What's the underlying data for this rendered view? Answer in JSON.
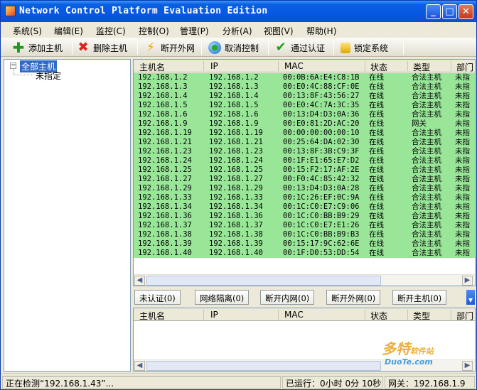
{
  "window": {
    "title": "Network Control Platform Evaluation Edition"
  },
  "menu": [
    "系统(S)",
    "编辑(E)",
    "监控(C)",
    "控制(O)",
    "管理(P)",
    "分析(A)",
    "视图(V)",
    "帮助(H)"
  ],
  "toolbar": {
    "add": "添加主机",
    "delete": "删除主机",
    "disconnect_ext": "断开外网",
    "cancel_control": "取消控制",
    "pass_auth": "通过认证",
    "lock": "锁定系统"
  },
  "tree": {
    "root": "全部主机",
    "child": "未指定"
  },
  "columns": [
    "主机名",
    "IP",
    "MAC",
    "状态",
    "类型",
    "部门"
  ],
  "hosts": [
    {
      "name": "192.168.1.2",
      "ip": "192.168.1.2",
      "mac": "00:0B:6A:E4:C8:1B",
      "status": "在线",
      "type": "合法主机",
      "dept": "未指"
    },
    {
      "name": "192.168.1.3",
      "ip": "192.168.1.3",
      "mac": "00:E0:4C:88:CF:0E",
      "status": "在线",
      "type": "合法主机",
      "dept": "未指"
    },
    {
      "name": "192.168.1.4",
      "ip": "192.168.1.4",
      "mac": "00:13:8F:43:56:27",
      "status": "在线",
      "type": "合法主机",
      "dept": "未指"
    },
    {
      "name": "192.168.1.5",
      "ip": "192.168.1.5",
      "mac": "00:E0:4C:7A:3C:35",
      "status": "在线",
      "type": "合法主机",
      "dept": "未指"
    },
    {
      "name": "192.168.1.6",
      "ip": "192.168.1.6",
      "mac": "00:13:D4:D3:0A:36",
      "status": "在线",
      "type": "合法主机",
      "dept": "未指"
    },
    {
      "name": "192.168.1.9",
      "ip": "192.168.1.9",
      "mac": "00:E0:81:2D:AC:20",
      "status": "在线",
      "type": "网关",
      "dept": "未指"
    },
    {
      "name": "192.168.1.19",
      "ip": "192.168.1.19",
      "mac": "00:00:00:00:00:10",
      "status": "在线",
      "type": "合法主机",
      "dept": "未指"
    },
    {
      "name": "192.168.1.21",
      "ip": "192.168.1.21",
      "mac": "00:25:64:DA:02:30",
      "status": "在线",
      "type": "合法主机",
      "dept": "未指"
    },
    {
      "name": "192.168.1.23",
      "ip": "192.168.1.23",
      "mac": "00:13:8F:3B:C9:3F",
      "status": "在线",
      "type": "合法主机",
      "dept": "未指"
    },
    {
      "name": "192.168.1.24",
      "ip": "192.168.1.24",
      "mac": "00:1F:E1:65:E7:D2",
      "status": "在线",
      "type": "合法主机",
      "dept": "未指"
    },
    {
      "name": "192.168.1.25",
      "ip": "192.168.1.25",
      "mac": "00:15:F2:17:AF:2E",
      "status": "在线",
      "type": "合法主机",
      "dept": "未指"
    },
    {
      "name": "192.168.1.27",
      "ip": "192.168.1.27",
      "mac": "00:F0:4C:85:42:32",
      "status": "在线",
      "type": "合法主机",
      "dept": "未指"
    },
    {
      "name": "192.168.1.29",
      "ip": "192.168.1.29",
      "mac": "00:13:D4:D3:0A:28",
      "status": "在线",
      "type": "合法主机",
      "dept": "未指"
    },
    {
      "name": "192.168.1.33",
      "ip": "192.168.1.33",
      "mac": "00:1C:26:EF:0C:9A",
      "status": "在线",
      "type": "合法主机",
      "dept": "未指"
    },
    {
      "name": "192.168.1.34",
      "ip": "192.168.1.34",
      "mac": "00:1C:C0:E7:C9:06",
      "status": "在线",
      "type": "合法主机",
      "dept": "未指"
    },
    {
      "name": "192.168.1.36",
      "ip": "192.168.1.36",
      "mac": "00:1C:C0:BB:B9:29",
      "status": "在线",
      "type": "合法主机",
      "dept": "未指"
    },
    {
      "name": "192.168.1.37",
      "ip": "192.168.1.37",
      "mac": "00:1C:C0:E7:E1:26",
      "status": "在线",
      "type": "合法主机",
      "dept": "未指"
    },
    {
      "name": "192.168.1.38",
      "ip": "192.168.1.38",
      "mac": "00:1C:C0:BB:B9:B3",
      "status": "在线",
      "type": "合法主机",
      "dept": "未指"
    },
    {
      "name": "192.168.1.39",
      "ip": "192.168.1.39",
      "mac": "00:15:17:9C:62:6E",
      "status": "在线",
      "type": "合法主机",
      "dept": "未指"
    },
    {
      "name": "192.168.1.40",
      "ip": "192.168.1.40",
      "mac": "00:1F:D0:53:DD:54",
      "status": "在线",
      "type": "合法主机",
      "dept": "未指"
    }
  ],
  "tabs": [
    "未认证(0)",
    "网络隔离(0)",
    "断开内网(0)",
    "断开外网(0)",
    "断开主机(0)"
  ],
  "status": {
    "detecting": "正在检测“192.168.1.43”...",
    "runtime": "已运行：0小时 0分 10秒",
    "gateway": "网关：192.168.1.9"
  },
  "watermark": {
    "brand": "多特",
    "brand_sub": "软件站",
    "site": "DuoTe.com"
  },
  "colors": {
    "online_row": "#99e699",
    "selection": "#316ac5",
    "titlebar": "#0758e3"
  }
}
